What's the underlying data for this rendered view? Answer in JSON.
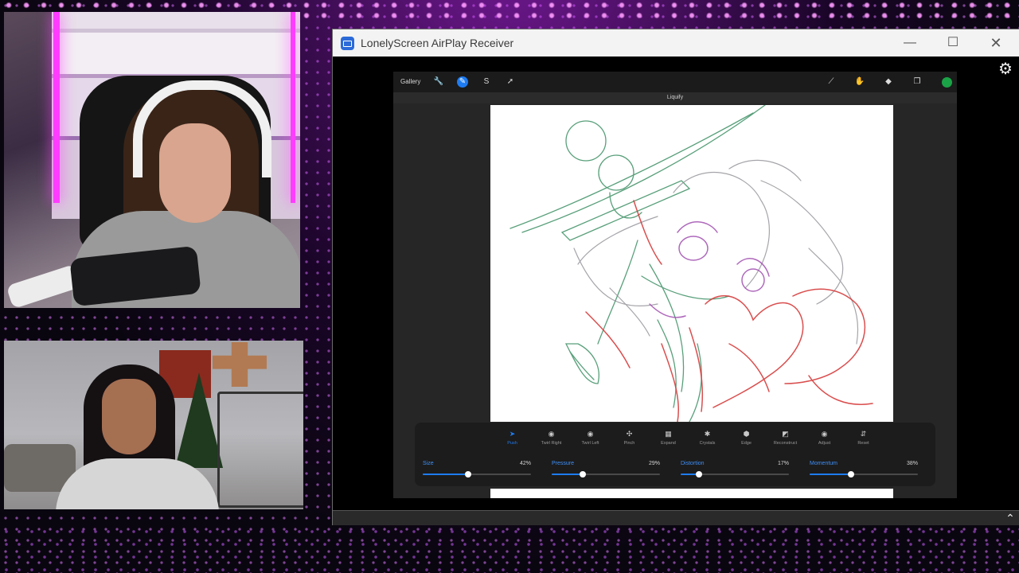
{
  "window": {
    "title": "LonelyScreen AirPlay Receiver",
    "minimize_glyph": "—",
    "maximize_glyph": "☐",
    "close_glyph": "✕",
    "settings_icon": "gear-icon",
    "scroll_arrow_glyph": "⌃"
  },
  "procreate": {
    "gallery": "Gallery",
    "tool_label": "Liquify",
    "active_color": "#1ba347",
    "accent_color": "#1e7cf2",
    "toolbar_icons": {
      "wrench": "🔧",
      "adjust": "✎",
      "select": "S",
      "move": "➚",
      "brush": "⟋",
      "smudge": "✋",
      "eraser": "◆",
      "layers": "❐"
    },
    "modes": [
      {
        "label": "Push",
        "glyph": "➤"
      },
      {
        "label": "Twirl Right",
        "glyph": "◉"
      },
      {
        "label": "Twirl Left",
        "glyph": "◉"
      },
      {
        "label": "Pinch",
        "glyph": "✣"
      },
      {
        "label": "Expand",
        "glyph": "▦"
      },
      {
        "label": "Crystals",
        "glyph": "✱"
      },
      {
        "label": "Edge",
        "glyph": "⬢"
      },
      {
        "label": "Reconstruct",
        "glyph": "◩"
      },
      {
        "label": "Adjust",
        "glyph": "◉"
      },
      {
        "label": "Reset",
        "glyph": "⇵"
      }
    ],
    "sliders": [
      {
        "label": "Size",
        "value": "42%",
        "fraction": 0.42
      },
      {
        "label": "Pressure",
        "value": "29%",
        "fraction": 0.29
      },
      {
        "label": "Distortion",
        "value": "17%",
        "fraction": 0.17
      },
      {
        "label": "Momentum",
        "value": "38%",
        "fraction": 0.38
      }
    ]
  }
}
